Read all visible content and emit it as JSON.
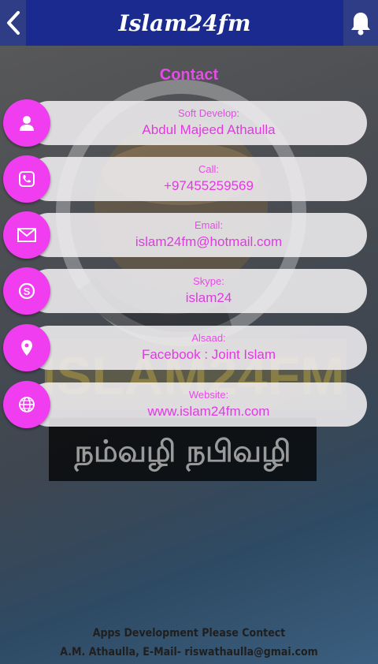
{
  "header": {
    "title": "Islam24fm",
    "back_icon": "chevron-left-icon",
    "bell_icon": "bell-icon"
  },
  "background": {
    "logo_text": "ISLAM24FM",
    "tagline": "நம்வழி நபிவழி"
  },
  "contact": {
    "title": "Contact",
    "items": [
      {
        "label": "Soft Develop:",
        "value": "Abdul Majeed Athaulla",
        "icon": "person-icon"
      },
      {
        "label": "Call:",
        "value": "+97455259569",
        "icon": "phone-icon"
      },
      {
        "label": "Email:",
        "value": "islam24fm@hotmail.com",
        "icon": "mail-icon"
      },
      {
        "label": "Skype:",
        "value": "islam24",
        "icon": "skype-icon"
      },
      {
        "label": "Alsaad:",
        "value": "Facebook : Joint Islam",
        "icon": "location-pin-icon"
      },
      {
        "label": "Website:",
        "value": "www.islam24fm.com",
        "icon": "globe-icon"
      }
    ]
  },
  "footer": {
    "line1": "Apps Development Please Contect",
    "line2": "A.M. Athaulla, E-Mail- riswathaulla@gmai.com"
  },
  "colors": {
    "accent": "#f03df0",
    "header": "#1a2a8f"
  }
}
